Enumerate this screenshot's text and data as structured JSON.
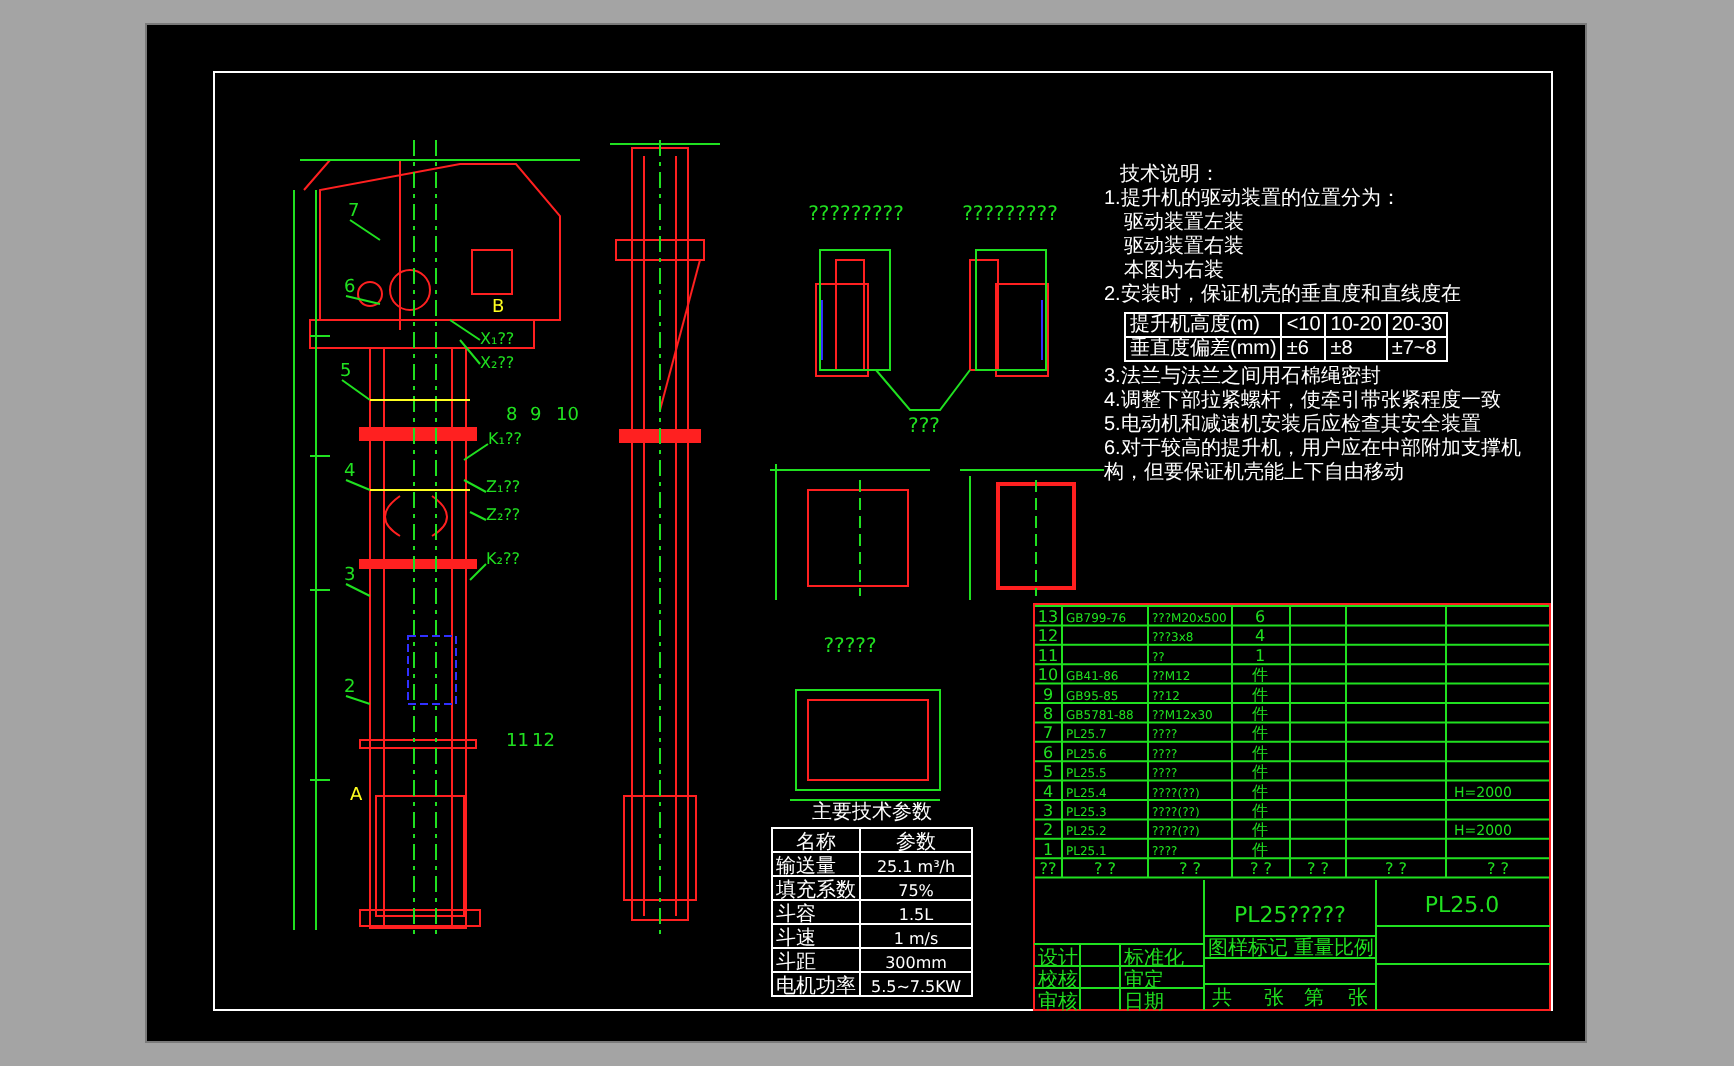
{
  "drawing": {
    "main_view_labels": [
      "7",
      "6",
      "5",
      "4",
      "3",
      "2",
      "8",
      "9",
      "10",
      "11",
      "12"
    ],
    "callouts": [
      "X₁??",
      "X₂??",
      "K₁??",
      "Z₁??",
      "Z₂??",
      "K₂??"
    ],
    "view_markers": [
      "B",
      "A"
    ],
    "detail_titles": [
      "?????????",
      "?????????",
      "???",
      "?????"
    ],
    "notes": [
      "技术说明：",
      "1.提升机的驱动装置的位置分为：",
      "驱动装置左装",
      "驱动装置右装",
      "本图为右装",
      "2.安装时，保证机壳的垂直度和直线度在"
    ],
    "notes_table": {
      "rows": [
        [
          "提升机高度(m)",
          "<10",
          "10-20",
          "20-30"
        ],
        [
          "垂直度偏差(mm)",
          "±6",
          "±8",
          "±7~8"
        ]
      ]
    },
    "notes_after": [
      "3.法兰与法兰之间用石棉绳密封",
      "4.调整下部拉紧螺杆，使牵引带张紧程度一致",
      "5.电动机和减速机安装后应检查其安全装置",
      "6.对于较高的提升机，用户应在中部附加支撑机构，但要保证机壳能上下自由移动"
    ],
    "spec_table": {
      "title": "主要技术参数",
      "columns": [
        "名称",
        "参数"
      ],
      "rows": [
        [
          "输送量",
          "25.1 m³/h"
        ],
        [
          "填充系数",
          "75%"
        ],
        [
          "斗容",
          "1.5L"
        ],
        [
          "斗速",
          "1 m/s"
        ],
        [
          "斗距",
          "300mm"
        ],
        [
          "电机功率",
          "5.5~7.5KW"
        ]
      ]
    },
    "parts_list": {
      "rows": [
        {
          "no": "13",
          "code": "GB799-76",
          "name": "???M20x500",
          "qty": "6",
          "remark": ""
        },
        {
          "no": "12",
          "code": "",
          "name": "???3x8",
          "qty": "4",
          "remark": ""
        },
        {
          "no": "11",
          "code": "",
          "name": "??",
          "qty": "1",
          "remark": ""
        },
        {
          "no": "10",
          "code": "GB41-86",
          "name": "??M12",
          "qty": "件",
          "remark": ""
        },
        {
          "no": "9",
          "code": "GB95-85",
          "name": "??12",
          "qty": "件",
          "remark": ""
        },
        {
          "no": "8",
          "code": "GB5781-88",
          "name": "??M12x30",
          "qty": "件",
          "remark": ""
        },
        {
          "no": "7",
          "code": "PL25.7",
          "name": "????",
          "qty": "件",
          "remark": ""
        },
        {
          "no": "6",
          "code": "PL25.6",
          "name": "????",
          "qty": "件",
          "remark": ""
        },
        {
          "no": "5",
          "code": "PL25.5",
          "name": "????",
          "qty": "件",
          "remark": ""
        },
        {
          "no": "4",
          "code": "PL25.4",
          "name": "????(??)",
          "qty": "件",
          "remark": "H=2000"
        },
        {
          "no": "3",
          "code": "PL25.3",
          "name": "????(??)",
          "qty": "件",
          "remark": ""
        },
        {
          "no": "2",
          "code": "PL25.2",
          "name": "????(??)",
          "qty": "件",
          "remark": "H=2000"
        },
        {
          "no": "1",
          "code": "PL25.1",
          "name": "????",
          "qty": "件",
          "remark": ""
        }
      ],
      "header": [
        "??",
        "? ?",
        "? ?",
        "? ?",
        "? ?",
        "? ?",
        "? ?"
      ]
    },
    "title_block": {
      "drawing_name": "PL25?????",
      "drawing_number": "PL25.0",
      "labels": [
        "图样标记",
        "重量",
        "比例"
      ],
      "sheet": [
        "共",
        "张",
        "第",
        "张"
      ],
      "signoff": [
        [
          "设计",
          "标准化"
        ],
        [
          "校核",
          "审定"
        ],
        [
          "审核",
          "日期"
        ]
      ]
    }
  }
}
